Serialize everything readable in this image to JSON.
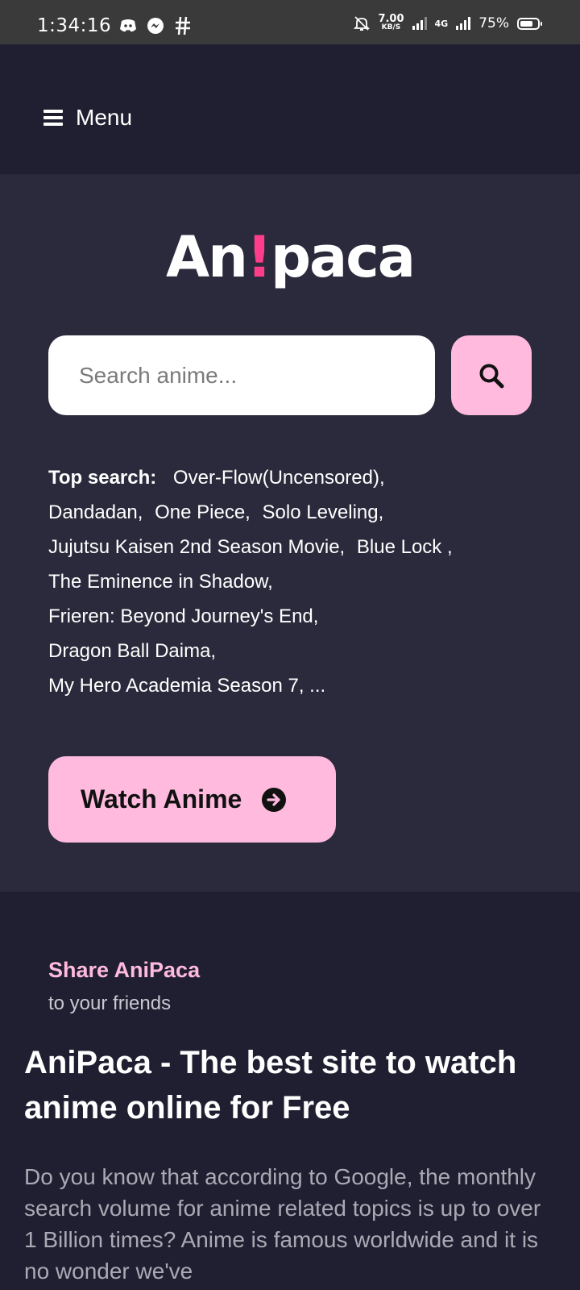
{
  "status_bar": {
    "time": "1:34:16",
    "net_speed_value": "7.00",
    "net_speed_unit": "KB/S",
    "network_type": "4G",
    "battery": "75%",
    "battery_level": 0.75
  },
  "header": {
    "menu_label": "Menu"
  },
  "logo": {
    "part1": "An",
    "bang": "!",
    "part2": "paca",
    "accent_color": "#ff3d8b"
  },
  "search": {
    "placeholder": "Search anime...",
    "value": ""
  },
  "top_search": {
    "label": "Top search:",
    "items": [
      "Over-Flow(Uncensored),",
      "Dandadan,",
      "One Piece,",
      "Solo Leveling,",
      "Jujutsu Kaisen 2nd Season Movie,",
      "Blue Lock ,",
      "The Eminence in Shadow,",
      "Frieren: Beyond Journey's End,",
      "Dragon Ball Daima,",
      "My Hero Academia Season 7, ..."
    ]
  },
  "watch_button": {
    "label": "Watch Anime"
  },
  "share": {
    "title": "Share AniPaca",
    "subtitle": "to your friends"
  },
  "about": {
    "title": "AniPaca - The best site to watch anime online for Free",
    "text": "Do you know that according to Google, the monthly search volume for anime related topics is up to over 1 Billion times? Anime is famous worldwide and it is no wonder we've"
  },
  "colors": {
    "accent": "#ffbade",
    "background": "#201f31",
    "hero_bg": "#2b2a3c"
  }
}
